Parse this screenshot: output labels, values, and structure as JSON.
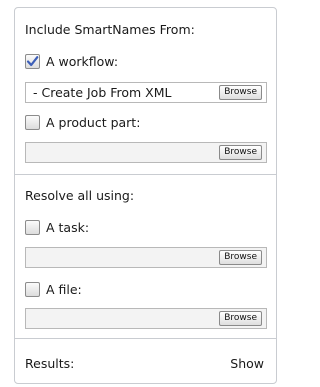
{
  "include": {
    "title": "Include SmartNames From:",
    "workflow": {
      "label": "A workflow:",
      "checked": true,
      "value": "- Create Job From XML",
      "browse_label": "Browse"
    },
    "product_part": {
      "label": "A product part:",
      "checked": false,
      "value": "",
      "browse_label": "Browse"
    }
  },
  "resolve": {
    "title": "Resolve all using:",
    "task": {
      "label": "A task:",
      "checked": false,
      "value": "",
      "browse_label": "Browse"
    },
    "file": {
      "label": "A file:",
      "checked": false,
      "value": "",
      "browse_label": "Browse"
    }
  },
  "results": {
    "label": "Results:",
    "show_label": "Show"
  },
  "colors": {
    "check_mark": "#3d5fb8",
    "border": "#c9ccd1"
  },
  "icons": {
    "checkbox_checked": "checkmark-icon"
  }
}
